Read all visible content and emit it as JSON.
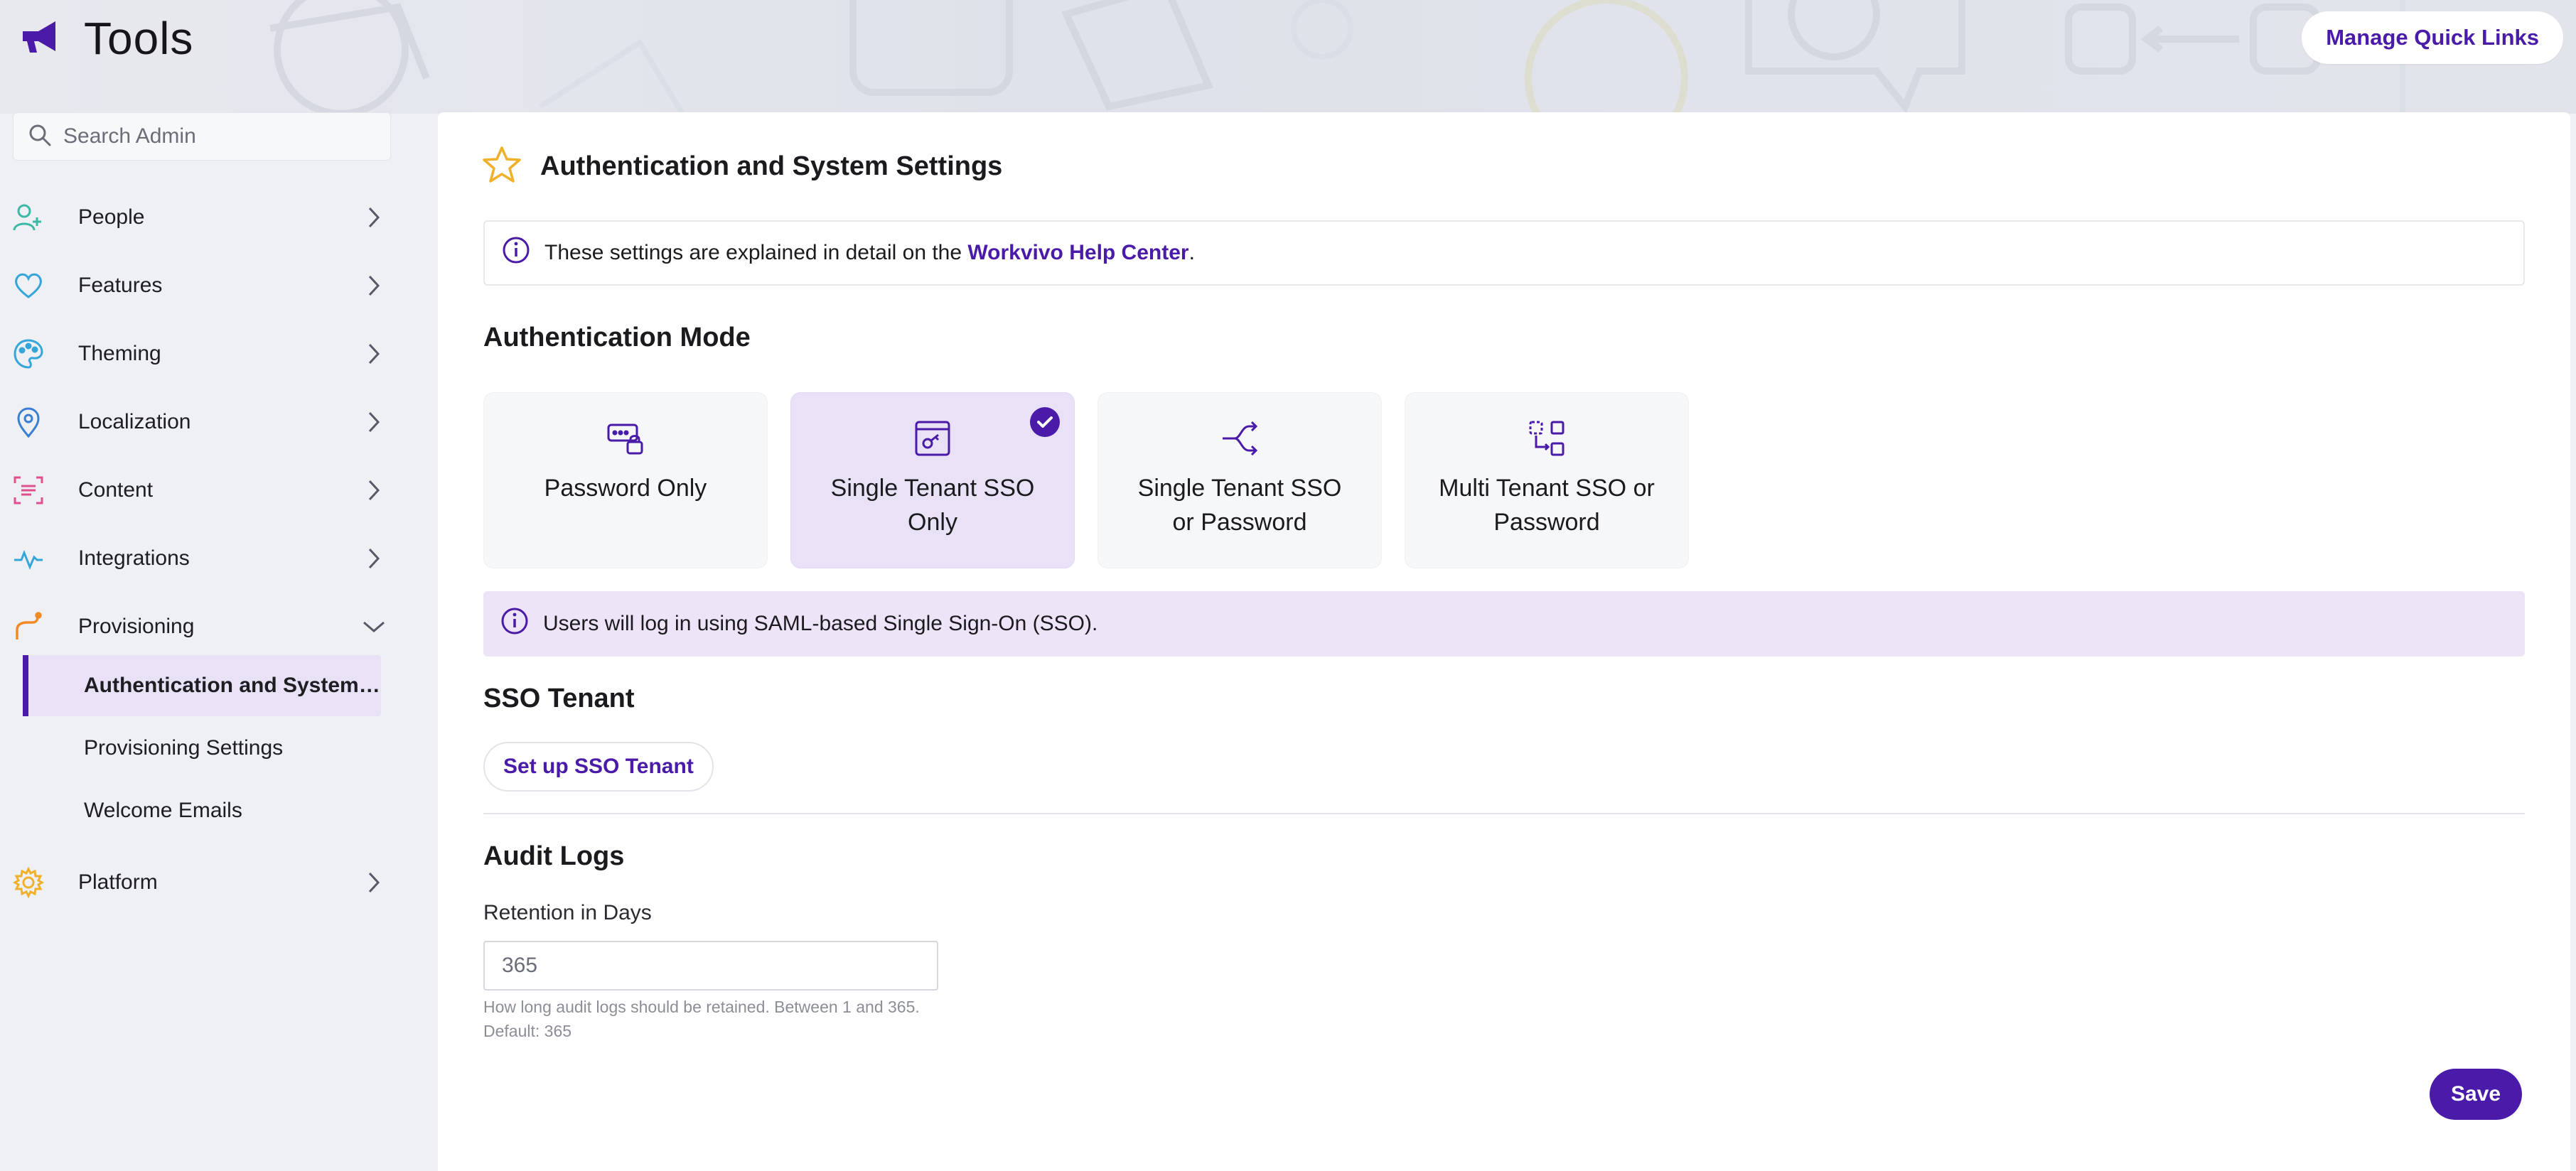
{
  "header": {
    "title": "Tools",
    "manage_quick_links": "Manage Quick Links",
    "logo_icon": "megaphone-icon"
  },
  "search": {
    "placeholder": "Search Admin"
  },
  "sidebar": {
    "items": [
      {
        "label": "People",
        "icon": "add-person-icon",
        "color": "#3bb8a6"
      },
      {
        "label": "Features",
        "icon": "heart-icon",
        "color": "#35a6d9"
      },
      {
        "label": "Theming",
        "icon": "palette-icon",
        "color": "#35a6d9"
      },
      {
        "label": "Localization",
        "icon": "location-pin-icon",
        "color": "#3a7fd1"
      },
      {
        "label": "Content",
        "icon": "scan-content-icon",
        "color": "#e0508e"
      },
      {
        "label": "Integrations",
        "icon": "activity-icon",
        "color": "#35a6d9"
      },
      {
        "label": "Provisioning",
        "icon": "route-icon",
        "color": "#f08a24"
      },
      {
        "label": "Platform",
        "icon": "gear-icon",
        "color": "#f0b02a"
      }
    ],
    "sub_items": [
      {
        "label": "Authentication and System…"
      },
      {
        "label": "Provisioning Settings"
      },
      {
        "label": "Welcome Emails"
      }
    ]
  },
  "page": {
    "title": "Authentication and System Settings",
    "info_prefix": "These settings are explained in detail on the ",
    "info_link": "Workvivo Help Center",
    "info_suffix": ".",
    "auth_mode_title": "Authentication Mode",
    "modes": [
      {
        "line1": "Password Only",
        "line2": "",
        "selected": false
      },
      {
        "line1": "Single Tenant SSO",
        "line2": "Only",
        "selected": true
      },
      {
        "line1": "Single Tenant SSO",
        "line2": "or Password",
        "selected": false
      },
      {
        "line1": "Multi Tenant SSO or",
        "line2": "Password",
        "selected": false
      }
    ],
    "notice": "Users will log in using SAML-based Single Sign-On (SSO).",
    "sso_title": "SSO Tenant",
    "sso_button": "Set up SSO Tenant",
    "audit_title": "Audit Logs",
    "retention_label": "Retention in Days",
    "retention_value": "365",
    "help_line1": "How long audit logs should be retained. Between 1 and 365.",
    "help_line2": "Default: 365",
    "save": "Save"
  },
  "colors": {
    "accent": "#4a1aa8",
    "selected_bg": "#e9e2f6",
    "star": "#f0b02a"
  }
}
